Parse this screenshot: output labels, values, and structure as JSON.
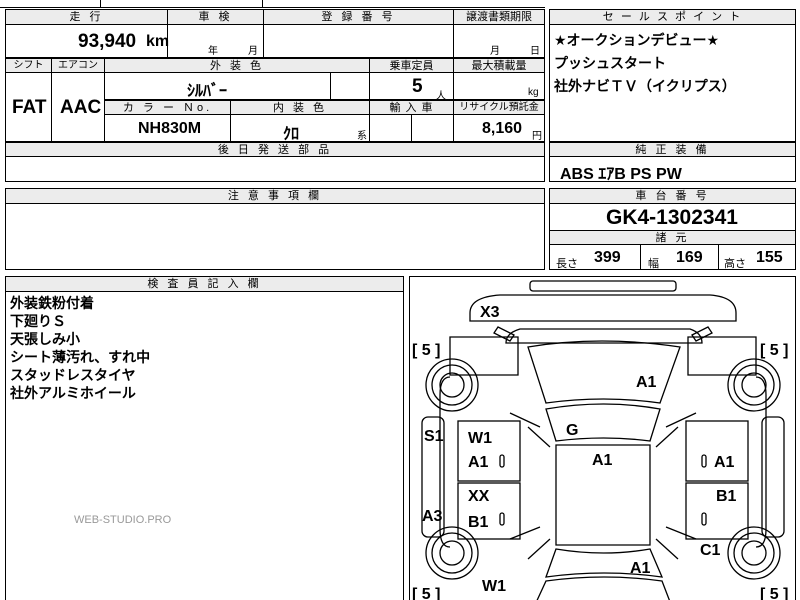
{
  "mileage": {
    "header": "走 行",
    "value": "93,940",
    "unit": "km"
  },
  "inspection": {
    "header": "車 検",
    "year": "年",
    "month": "月"
  },
  "registration": {
    "header": "登 録 番 号",
    "value": ""
  },
  "transfer": {
    "header": "譲渡書類期限",
    "month": "月",
    "day": "日"
  },
  "shift": {
    "header": "シフト",
    "value": "FAT"
  },
  "aircon": {
    "header": "エアコン",
    "value": "AAC"
  },
  "exterior_color": {
    "header": "外 装 色",
    "value": "ｼﾙﾊﾞｰ"
  },
  "capacity": {
    "header": "乗車定員",
    "value": "5",
    "unit": "人"
  },
  "max_load": {
    "header": "最大積載量",
    "unit": "kg"
  },
  "color_no": {
    "header": "カ ラ ー Ｎo.",
    "value": "NH830M"
  },
  "interior_color": {
    "header": "内 装 色",
    "value": "ｸﾛ",
    "suffix": "系"
  },
  "import": {
    "header": "輸 入 車"
  },
  "recycle": {
    "header": "リサイクル預託金",
    "value": "8,160",
    "unit": "円"
  },
  "later_parts": {
    "header": "後 日 発 送 部 品"
  },
  "sales_points": {
    "header": "セ ー ル ス ポ イ ン ト",
    "lines": [
      "★オークションデビュー★",
      "プッシュスタート",
      "社外ナビＴＶ（イクリプス）"
    ]
  },
  "equipment": {
    "header": "純 正 装 備",
    "value": "ABS ｴｱB PS PW"
  },
  "notes": {
    "header": "注 意 事 項 欄"
  },
  "chassis": {
    "header": "車 台 番 号",
    "value": "GK4-1302341"
  },
  "specs": {
    "header": "諸 元",
    "length_label": "長さ",
    "length": "399",
    "width_label": "幅",
    "width": "169",
    "height_label": "高さ",
    "height": "155"
  },
  "inspector": {
    "header": "検 査 員 記 入 欄",
    "lines": [
      "外装鉄粉付着",
      "下廻りＳ",
      "天張しみ小",
      "シート薄汚れ、すれ中",
      "スタッドレスタイヤ",
      "社外アルミホイール"
    ]
  },
  "watermark": "WEB-STUDIO.PRO",
  "diagram": {
    "tire_fl": "[ 5 ]",
    "tire_fr": "[ 5 ]",
    "tire_rl": "[ 5 ]",
    "tire_rr": "[ 5 ]",
    "front_bumper": "X3",
    "hood": "A1",
    "windshield": "G",
    "roof": "A1",
    "left_rocker": "S1",
    "left_front_door_1": "W1",
    "left_front_door_2": "A1",
    "left_rear_door_1": "XX",
    "left_rear_door_2": "B1",
    "left_quarter": "A3",
    "left_rear_fender": "W1",
    "right_front_door": "A1",
    "right_rear_door": "B1",
    "right_rear_fender": "C1",
    "trunk": "A1"
  }
}
